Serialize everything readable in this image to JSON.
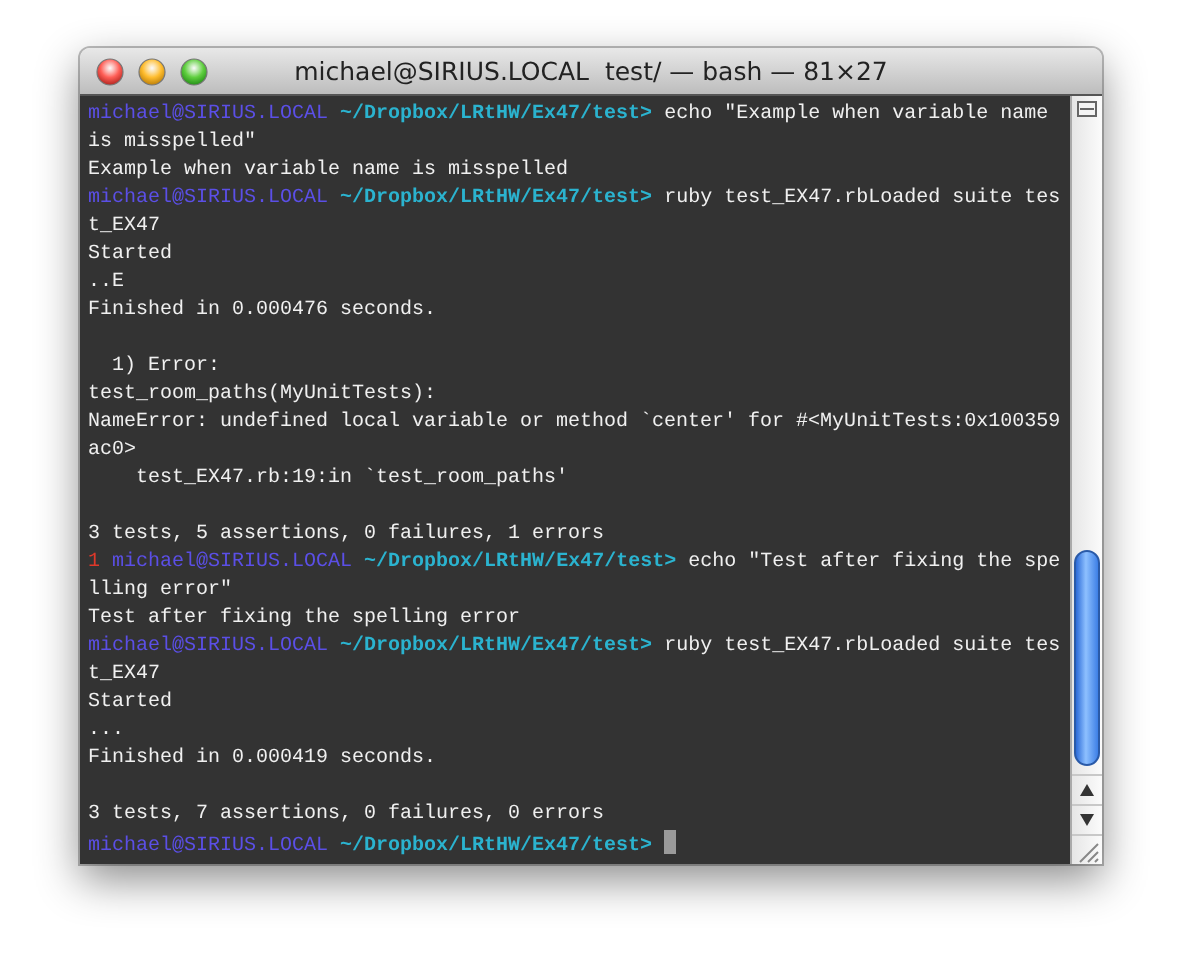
{
  "window": {
    "title": "michael@SIRIUS.LOCAL  test/ — bash — 81×27"
  },
  "terminal": {
    "cursor_visible": true,
    "lines": [
      {
        "kind": "text",
        "segments": [
          {
            "kind": "user",
            "text": "michael@SIRIUS.LOCAL"
          },
          {
            "kind": "path",
            "text": "~/Dropbox/LRtHW/Ex47/test>"
          },
          {
            "kind": "plain",
            "text": "echo \"Example when variable name"
          }
        ]
      },
      {
        "kind": "text",
        "segments": [
          {
            "kind": "plain",
            "text": "is misspelled\""
          }
        ]
      },
      {
        "kind": "text",
        "segments": [
          {
            "kind": "plain",
            "text": "Example when variable name is misspelled"
          }
        ]
      },
      {
        "kind": "text",
        "segments": [
          {
            "kind": "user",
            "text": "michael@SIRIUS.LOCAL"
          },
          {
            "kind": "path",
            "text": "~/Dropbox/LRtHW/Ex47/test>"
          },
          {
            "kind": "plain",
            "text": "ruby test_EX47.rbLoaded suite tes"
          }
        ]
      },
      {
        "kind": "text",
        "segments": [
          {
            "kind": "plain",
            "text": "t_EX47"
          }
        ]
      },
      {
        "kind": "text",
        "segments": [
          {
            "kind": "plain",
            "text": "Started"
          }
        ]
      },
      {
        "kind": "text",
        "segments": [
          {
            "kind": "plain",
            "text": "..E"
          }
        ]
      },
      {
        "kind": "text",
        "segments": [
          {
            "kind": "plain",
            "text": "Finished in 0.000476 seconds."
          }
        ]
      },
      {
        "kind": "blank"
      },
      {
        "kind": "text",
        "segments": [
          {
            "kind": "plain",
            "text": "  1) Error:"
          }
        ]
      },
      {
        "kind": "text",
        "segments": [
          {
            "kind": "plain",
            "text": "test_room_paths(MyUnitTests):"
          }
        ]
      },
      {
        "kind": "text",
        "segments": [
          {
            "kind": "plain",
            "text": "NameError: undefined local variable or method `center' for #<MyUnitTests:0x100359"
          }
        ]
      },
      {
        "kind": "text",
        "segments": [
          {
            "kind": "plain",
            "text": "ac0>"
          }
        ]
      },
      {
        "kind": "text",
        "segments": [
          {
            "kind": "plain",
            "text": "    test_EX47.rb:19:in `test_room_paths'"
          }
        ]
      },
      {
        "kind": "blank"
      },
      {
        "kind": "text",
        "segments": [
          {
            "kind": "plain",
            "text": "3 tests, 5 assertions, 0 failures, 1 errors"
          }
        ]
      },
      {
        "kind": "text",
        "segments": [
          {
            "kind": "status",
            "text": "1"
          },
          {
            "kind": "user",
            "text": "michael@SIRIUS.LOCAL"
          },
          {
            "kind": "path",
            "text": "~/Dropbox/LRtHW/Ex47/test>"
          },
          {
            "kind": "plain",
            "text": "echo \"Test after fixing the spe"
          }
        ]
      },
      {
        "kind": "text",
        "segments": [
          {
            "kind": "plain",
            "text": "lling error\""
          }
        ]
      },
      {
        "kind": "text",
        "segments": [
          {
            "kind": "plain",
            "text": "Test after fixing the spelling error"
          }
        ]
      },
      {
        "kind": "text",
        "segments": [
          {
            "kind": "user",
            "text": "michael@SIRIUS.LOCAL"
          },
          {
            "kind": "path",
            "text": "~/Dropbox/LRtHW/Ex47/test>"
          },
          {
            "kind": "plain",
            "text": "ruby test_EX47.rbLoaded suite tes"
          }
        ]
      },
      {
        "kind": "text",
        "segments": [
          {
            "kind": "plain",
            "text": "t_EX47"
          }
        ]
      },
      {
        "kind": "text",
        "segments": [
          {
            "kind": "plain",
            "text": "Started"
          }
        ]
      },
      {
        "kind": "text",
        "segments": [
          {
            "kind": "plain",
            "text": "..."
          }
        ]
      },
      {
        "kind": "text",
        "segments": [
          {
            "kind": "plain",
            "text": "Finished in 0.000419 seconds."
          }
        ]
      },
      {
        "kind": "blank"
      },
      {
        "kind": "text",
        "segments": [
          {
            "kind": "plain",
            "text": "3 tests, 7 assertions, 0 failures, 0 errors"
          }
        ]
      },
      {
        "kind": "text",
        "segments": [
          {
            "kind": "user",
            "text": "michael@SIRIUS.LOCAL"
          },
          {
            "kind": "path",
            "text": "~/Dropbox/LRtHW/Ex47/test>"
          }
        ]
      }
    ]
  }
}
